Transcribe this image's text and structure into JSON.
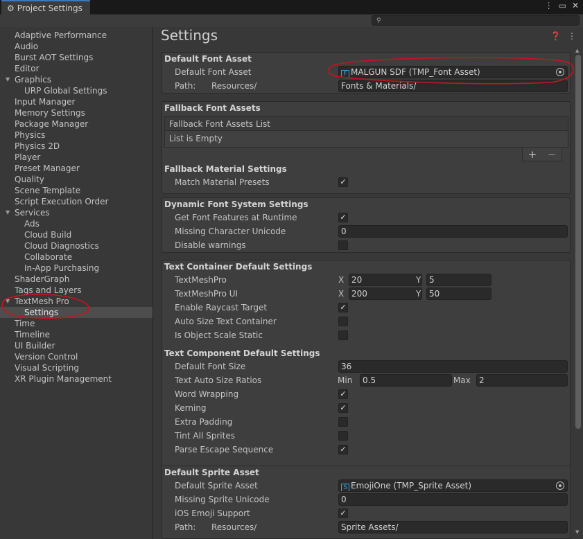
{
  "window": {
    "tab_label": "Project Settings",
    "tab_icon": "gear-icon",
    "controls": {
      "menu": "⋮",
      "maximize": "🗖",
      "close": "✕"
    }
  },
  "search": {
    "icon": "search-icon",
    "value": ""
  },
  "sidebar": {
    "items": [
      {
        "label": "Adaptive Performance",
        "level": 0
      },
      {
        "label": "Audio",
        "level": 0
      },
      {
        "label": "Burst AOT Settings",
        "level": 0
      },
      {
        "label": "Editor",
        "level": 0
      },
      {
        "label": "Graphics",
        "level": 0,
        "expanded": true
      },
      {
        "label": "URP Global Settings",
        "level": 1
      },
      {
        "label": "Input Manager",
        "level": 0
      },
      {
        "label": "Memory Settings",
        "level": 0
      },
      {
        "label": "Package Manager",
        "level": 0
      },
      {
        "label": "Physics",
        "level": 0
      },
      {
        "label": "Physics 2D",
        "level": 0
      },
      {
        "label": "Player",
        "level": 0
      },
      {
        "label": "Preset Manager",
        "level": 0
      },
      {
        "label": "Quality",
        "level": 0
      },
      {
        "label": "Scene Template",
        "level": 0
      },
      {
        "label": "Script Execution Order",
        "level": 0
      },
      {
        "label": "Services",
        "level": 0,
        "expanded": true
      },
      {
        "label": "Ads",
        "level": 1
      },
      {
        "label": "Cloud Build",
        "level": 1
      },
      {
        "label": "Cloud Diagnostics",
        "level": 1
      },
      {
        "label": "Collaborate",
        "level": 1
      },
      {
        "label": "In-App Purchasing",
        "level": 1
      },
      {
        "label": "ShaderGraph",
        "level": 0
      },
      {
        "label": "Tags and Layers",
        "level": 0
      },
      {
        "label": "TextMesh Pro",
        "level": 0,
        "expanded": true
      },
      {
        "label": "Settings",
        "level": 1,
        "selected": true
      },
      {
        "label": "Time",
        "level": 0
      },
      {
        "label": "Timeline",
        "level": 0
      },
      {
        "label": "UI Builder",
        "level": 0
      },
      {
        "label": "Version Control",
        "level": 0
      },
      {
        "label": "Visual Scripting",
        "level": 0
      },
      {
        "label": "XR Plugin Management",
        "level": 0
      }
    ]
  },
  "main": {
    "title": "Settings",
    "help_icon": "help-icon",
    "menu_icon": "kebab-menu-icon",
    "default_font": {
      "header": "Default Font Asset",
      "asset_label": "Default Font Asset",
      "asset_icon": "F",
      "asset_value": "MALGUN SDF (TMP_Font Asset)",
      "path_label": "Path:",
      "path_prefix": "Resources/",
      "path_value": "Fonts & Materials/"
    },
    "fallback": {
      "header": "Fallback Font Assets",
      "list_header": "Fallback Font Assets List",
      "list_empty": "List is Empty",
      "add": "+",
      "remove": "−",
      "material_header": "Fallback Material Settings",
      "match_label": "Match Material Presets",
      "match_checked": true
    },
    "dynamic": {
      "header": "Dynamic Font System Settings",
      "get_features_label": "Get Font Features at Runtime",
      "get_features_checked": true,
      "missing_char_label": "Missing Character Unicode",
      "missing_char_value": "0",
      "disable_warnings_label": "Disable warnings",
      "disable_warnings_checked": false
    },
    "container": {
      "header": "Text Container Default Settings",
      "tmp_label": "TextMeshPro",
      "tmp_x": "20",
      "tmp_y": "5",
      "tmpui_label": "TextMeshPro UI",
      "tmpui_x": "200",
      "tmpui_y": "50",
      "x_label": "X",
      "y_label": "Y",
      "raycast_label": "Enable Raycast Target",
      "raycast_checked": true,
      "autosize_label": "Auto Size Text Container",
      "autosize_checked": false,
      "scale_static_label": "Is Object Scale Static",
      "scale_static_checked": false
    },
    "component": {
      "header": "Text Component Default Settings",
      "font_size_label": "Default Font Size",
      "font_size_value": "36",
      "ratios_label": "Text Auto Size Ratios",
      "min_label": "Min",
      "min_value": "0.5",
      "max_label": "Max",
      "max_value": "2",
      "wrap_label": "Word Wrapping",
      "wrap_checked": true,
      "kerning_label": "Kerning",
      "kerning_checked": true,
      "padding_label": "Extra Padding",
      "padding_checked": false,
      "tint_label": "Tint All Sprites",
      "tint_checked": false,
      "escape_label": "Parse Escape Sequence",
      "escape_checked": true
    },
    "sprite": {
      "header": "Default Sprite Asset",
      "asset_label": "Default Sprite Asset",
      "asset_icon": "S",
      "asset_value": "EmojiOne (TMP_Sprite Asset)",
      "missing_label": "Missing Sprite Unicode",
      "missing_value": "0",
      "emoji_label": "iOS Emoji Support",
      "emoji_checked": true,
      "path_label": "Path:",
      "path_prefix": "Resources/",
      "path_value": "Sprite Assets/"
    }
  },
  "annotation_color": "#c8141e",
  "colors": {
    "accent": "#3a79bb",
    "asset_icon": "#3aa0e0"
  }
}
